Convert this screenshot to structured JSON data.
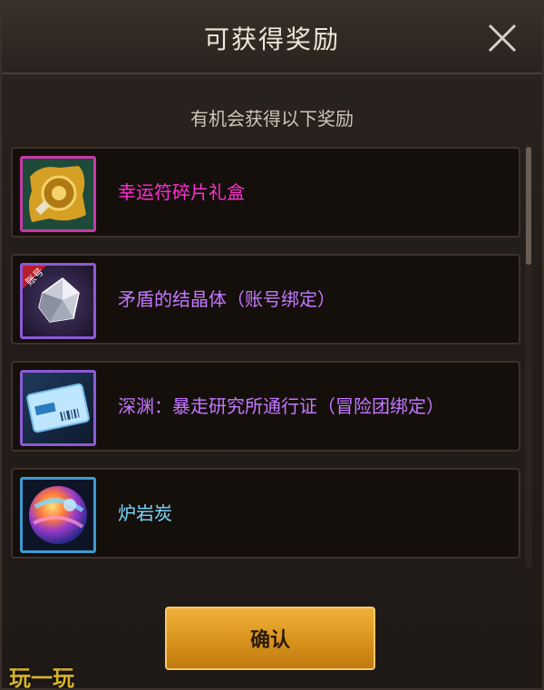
{
  "dialog": {
    "title": "可获得奖励",
    "subtitle": "有机会获得以下奖励",
    "close_icon": "close-icon",
    "confirm_label": "确认"
  },
  "rewards": [
    {
      "name": "幸运符碎片礼盒",
      "color": "#ff2fd0",
      "frame": "#c63aa8",
      "icon": "lucky-charm-box-icon"
    },
    {
      "name": "矛盾的结晶体（账号绑定）",
      "color": "#c478ff",
      "frame": "#8c5ad6",
      "icon": "crystal-icon",
      "badge": "账号"
    },
    {
      "name": "深渊：暴走研究所通行证（冒险团绑定）",
      "color": "#c478ff",
      "frame": "#8c5ad6",
      "icon": "ticket-icon"
    },
    {
      "name": "炉岩炭",
      "color": "#79d9ff",
      "frame": "#3c9ad0",
      "icon": "orb-icon"
    }
  ],
  "watermark": "玩一玩"
}
